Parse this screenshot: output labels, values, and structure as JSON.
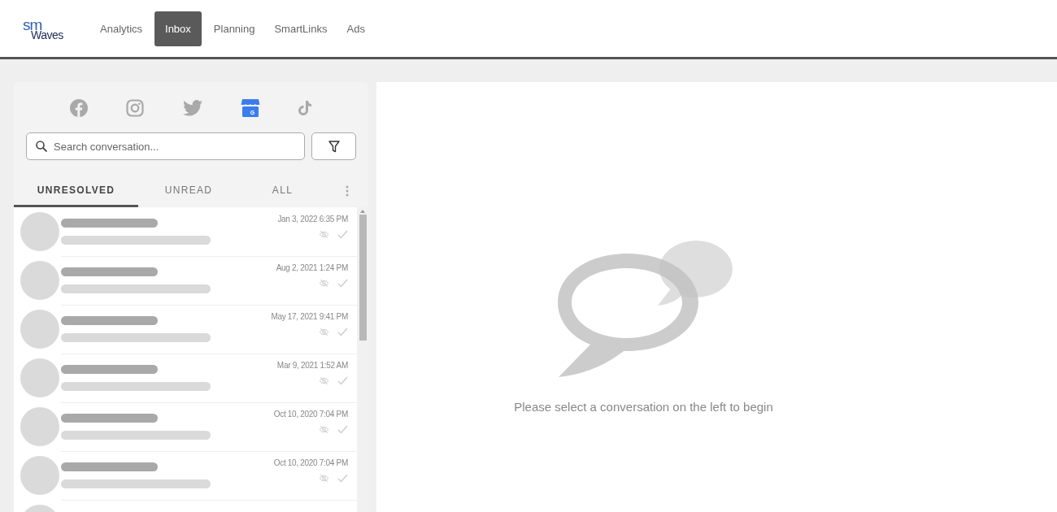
{
  "logo": {
    "top": "sm",
    "bottom": "Waves"
  },
  "nav": [
    {
      "label": "Analytics",
      "selected": false
    },
    {
      "label": "Inbox",
      "selected": true
    },
    {
      "label": "Planning",
      "selected": false
    },
    {
      "label": "SmartLinks",
      "selected": false
    },
    {
      "label": "Ads",
      "selected": false
    }
  ],
  "platforms": [
    {
      "kind": "facebook",
      "selected": false
    },
    {
      "kind": "instagram",
      "selected": false
    },
    {
      "kind": "twitter",
      "selected": false
    },
    {
      "kind": "business",
      "selected": true,
      "badge": "G"
    },
    {
      "kind": "tiktok",
      "selected": false
    }
  ],
  "search": {
    "placeholder": "Search conversation..."
  },
  "tabs": [
    {
      "label": "UNRESOLVED",
      "selected": true
    },
    {
      "label": "UNREAD",
      "selected": false
    },
    {
      "label": "ALL",
      "selected": false
    }
  ],
  "conversations": [
    {
      "time": "Jan 3, 2022 6:35 PM"
    },
    {
      "time": "Aug 2, 2021 1:24 PM"
    },
    {
      "time": "May 17, 2021 9:41 PM"
    },
    {
      "time": "Mar 9, 2021 1:52 AM"
    },
    {
      "time": "Oct 10, 2020 7:04 PM"
    },
    {
      "time": "Oct 10, 2020 7:04 PM"
    }
  ],
  "empty_state": {
    "message": "Please select a conversation on the left to begin"
  }
}
